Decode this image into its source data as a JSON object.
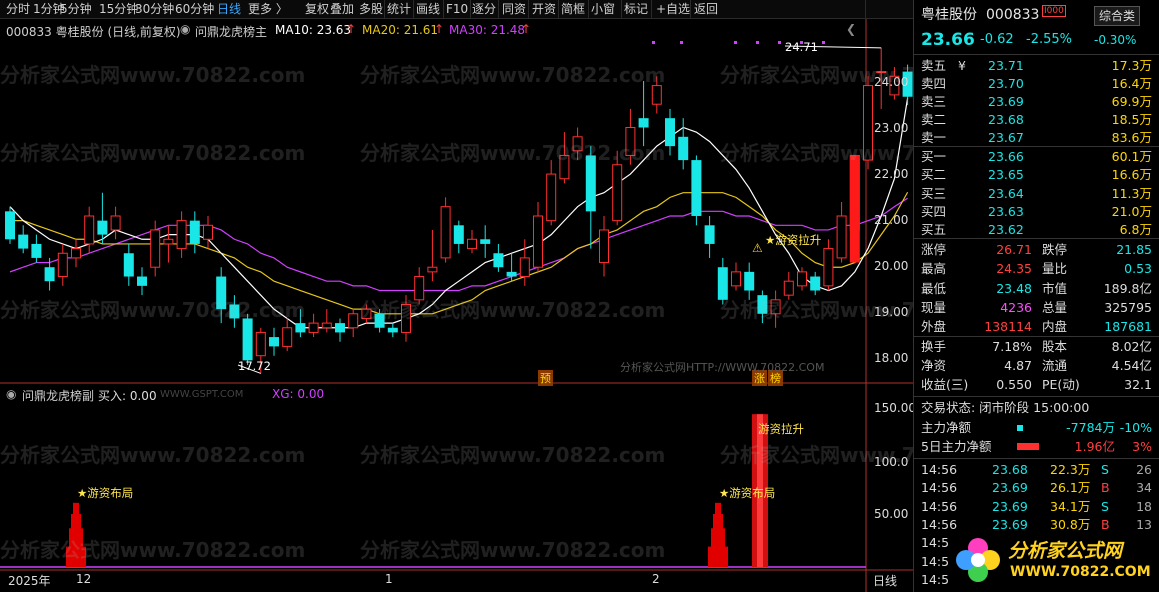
{
  "toolbar": {
    "items": [
      "分时",
      "1分钟",
      "5分钟",
      "15分钟",
      "30分钟",
      "60分钟",
      "日线",
      "更多 〉",
      "复权",
      "叠加",
      "多股",
      "统计",
      "画线",
      "F10",
      "逐分",
      "同资",
      "开资",
      "简框",
      "小窗",
      "标记",
      "+自选",
      "返回"
    ],
    "active": "日线"
  },
  "chart_header": {
    "code_title": "000833 粤桂股份 (日线,前复权)",
    "indicator_name": "问鼎龙虎榜主",
    "ma10": "MA10: 23.63",
    "ma20": "MA20: 21.61",
    "ma30": "MA30: 21.48",
    "up_arrow": "↑"
  },
  "price_axis": [
    "24.00",
    "23.00",
    "22.00",
    "21.00",
    "20.00",
    "19.00",
    "18.00"
  ],
  "labels": {
    "high": "24.71",
    "low": "17.72",
    "pre_tag": "预",
    "zhangting_tag": "涨",
    "bang_tag": "榜",
    "youzi_lasheng": "★游资拉升",
    "youzi_buju": "★游资布局",
    "watermark_url": "分析家公式网HTTP://WWW.70822.COM",
    "sub_youzi_lasheng": "游资拉升"
  },
  "sub_header": {
    "name": "问鼎龙虎榜副",
    "buy": "买入: 0.00",
    "site": "WWW.GSPT.COM",
    "xg": "XG: 0.00"
  },
  "sub_axis": [
    "150.00",
    "100.0",
    "50.00"
  ],
  "date_axis": {
    "year": "2025年",
    "m12": "12",
    "m1": "1",
    "m2": "2",
    "period": "日线"
  },
  "watermark": "分析家公式网www.70822.com",
  "stock": {
    "name": "粤桂股份",
    "code": "000833",
    "badge": "综合类",
    "price": "23.66",
    "change": "-0.62",
    "change_pct": "-2.55%",
    "small_pct": "-0.30%"
  },
  "asks": [
    {
      "label": "卖五",
      "extra": "¥",
      "price": "23.71",
      "vol": "17.3万"
    },
    {
      "label": "卖四",
      "extra": "",
      "price": "23.70",
      "vol": "16.4万"
    },
    {
      "label": "卖三",
      "extra": "",
      "price": "23.69",
      "vol": "69.9万"
    },
    {
      "label": "卖二",
      "extra": "",
      "price": "23.68",
      "vol": "18.5万"
    },
    {
      "label": "卖一",
      "extra": "",
      "price": "23.67",
      "vol": "83.6万"
    }
  ],
  "bids": [
    {
      "label": "买一",
      "price": "23.66",
      "vol": "60.1万"
    },
    {
      "label": "买二",
      "price": "23.65",
      "vol": "16.6万"
    },
    {
      "label": "买三",
      "price": "23.64",
      "vol": "11.3万"
    },
    {
      "label": "买四",
      "price": "23.63",
      "vol": "21.0万"
    },
    {
      "label": "买五",
      "price": "23.62",
      "vol": "6.8万"
    }
  ],
  "stats": [
    {
      "l1": "涨停",
      "v1": "26.71",
      "l2": "跌停",
      "v2": "21.85"
    },
    {
      "l1": "最高",
      "v1": "24.35",
      "l2": "量比",
      "v2": "0.53"
    },
    {
      "l1": "最低",
      "v1": "23.48",
      "l2": "市值",
      "v2": "189.8亿"
    },
    {
      "l1": "现量",
      "v1": "4236",
      "l2": "总量",
      "v2": "325795"
    },
    {
      "l1": "外盘",
      "v1": "138114",
      "l2": "内盘",
      "v2": "187681"
    }
  ],
  "stats2": [
    {
      "l1": "换手",
      "v1": "7.18%",
      "l2": "股本",
      "v2": "8.02亿"
    },
    {
      "l1": "净资",
      "v1": "4.87",
      "l2": "流通",
      "v2": "4.54亿"
    },
    {
      "l1": "收益(三)",
      "v1": "0.550",
      "l2": "PE(动)",
      "v2": "32.1"
    }
  ],
  "trade_status": "交易状态: 闭市阶段 15:00:00",
  "capital": [
    {
      "label": "主力净额",
      "value": "-7784万",
      "pct": "-10%"
    },
    {
      "label": "5日主力净额",
      "value": "1.96亿",
      "pct": "3%"
    }
  ],
  "ticks": [
    {
      "time": "14:56",
      "price": "23.68",
      "vol": "22.3万",
      "side": "S",
      "n": "26"
    },
    {
      "time": "14:56",
      "price": "23.69",
      "vol": "26.1万",
      "side": "B",
      "n": "34"
    },
    {
      "time": "14:56",
      "price": "23.69",
      "vol": "34.1万",
      "side": "S",
      "n": "18"
    },
    {
      "time": "14:56",
      "price": "23.69",
      "vol": "30.8万",
      "side": "B",
      "n": "13"
    },
    {
      "time": "14:5",
      "price": "",
      "vol": "",
      "side": "",
      "n": ""
    },
    {
      "time": "14:5",
      "price": "",
      "vol": "",
      "side": "",
      "n": ""
    },
    {
      "time": "14:5",
      "price": "",
      "vol": "",
      "side": "",
      "n": ""
    }
  ],
  "logo": {
    "title": "分析家公式网",
    "url": "WWW.70822.COM"
  },
  "colors": {
    "up": "#ff3030",
    "down": "#19e6e6",
    "ma10": "#ffffff",
    "ma20": "#e6c619",
    "ma30": "#d040ff",
    "bg": "#000000"
  },
  "chart_data": {
    "type": "candlestick",
    "price_ylim": [
      17.6,
      24.9
    ],
    "candles": [
      [
        21.2,
        20.6,
        21.3,
        20.5
      ],
      [
        20.7,
        20.4,
        20.9,
        20.3
      ],
      [
        20.5,
        20.2,
        20.7,
        20.1
      ],
      [
        20.0,
        19.7,
        20.2,
        19.5
      ],
      [
        19.8,
        20.3,
        20.5,
        19.6
      ],
      [
        20.2,
        20.4,
        20.6,
        20.0
      ],
      [
        20.5,
        21.1,
        21.3,
        20.3
      ],
      [
        21.0,
        20.7,
        21.6,
        20.5
      ],
      [
        20.8,
        21.1,
        21.3,
        20.6
      ],
      [
        20.3,
        19.8,
        20.5,
        19.6
      ],
      [
        19.8,
        19.6,
        20.0,
        19.4
      ],
      [
        20.0,
        20.8,
        21.0,
        19.8
      ],
      [
        20.5,
        20.6,
        20.9,
        20.1
      ],
      [
        20.4,
        21.0,
        21.2,
        20.2
      ],
      [
        21.0,
        20.5,
        21.2,
        20.3
      ],
      [
        20.6,
        20.9,
        21.1,
        20.4
      ],
      [
        19.8,
        19.1,
        20.0,
        18.8
      ],
      [
        19.2,
        18.9,
        19.4,
        18.7
      ],
      [
        18.9,
        18.0,
        19.0,
        17.9
      ],
      [
        18.1,
        18.6,
        18.7,
        17.72
      ],
      [
        18.5,
        18.3,
        18.7,
        18.1
      ],
      [
        18.3,
        18.7,
        18.9,
        18.2
      ],
      [
        18.8,
        18.6,
        19.1,
        18.5
      ],
      [
        18.6,
        18.8,
        19.0,
        18.5
      ],
      [
        18.7,
        18.8,
        19.1,
        18.6
      ],
      [
        18.8,
        18.6,
        18.9,
        18.4
      ],
      [
        18.7,
        19.0,
        19.1,
        18.5
      ],
      [
        18.9,
        19.1,
        19.2,
        18.8
      ],
      [
        19.0,
        18.7,
        19.1,
        18.6
      ],
      [
        18.7,
        18.6,
        18.8,
        18.5
      ],
      [
        18.6,
        19.2,
        19.4,
        18.4
      ],
      [
        19.3,
        19.8,
        20.0,
        19.2
      ],
      [
        19.9,
        20.0,
        20.8,
        19.7
      ],
      [
        20.2,
        21.3,
        21.5,
        20.1
      ],
      [
        20.9,
        20.5,
        21.0,
        20.3
      ],
      [
        20.4,
        20.6,
        20.8,
        20.3
      ],
      [
        20.6,
        20.5,
        20.9,
        20.2
      ],
      [
        20.3,
        20.0,
        20.5,
        19.9
      ],
      [
        19.9,
        19.8,
        20.3,
        19.7
      ],
      [
        19.8,
        20.2,
        20.6,
        19.6
      ],
      [
        20.0,
        21.1,
        21.4,
        19.9
      ],
      [
        21.0,
        22.0,
        22.3,
        20.9
      ],
      [
        21.9,
        22.4,
        22.9,
        21.8
      ],
      [
        22.5,
        22.8,
        23.0,
        22.3
      ],
      [
        22.4,
        21.2,
        22.6,
        20.4
      ],
      [
        20.1,
        20.8,
        21.1,
        19.8
      ],
      [
        21.0,
        22.2,
        22.5,
        20.9
      ],
      [
        22.4,
        23.0,
        23.4,
        22.2
      ],
      [
        23.2,
        23.0,
        24.0,
        22.6
      ],
      [
        23.5,
        23.9,
        24.1,
        23.3
      ],
      [
        23.2,
        22.6,
        23.4,
        22.4
      ],
      [
        22.8,
        22.3,
        23.2,
        22.1
      ],
      [
        22.3,
        21.1,
        22.4,
        20.9
      ],
      [
        20.9,
        20.5,
        21.1,
        20.2
      ],
      [
        20.0,
        19.3,
        20.2,
        19.2
      ],
      [
        19.6,
        19.9,
        20.1,
        19.5
      ],
      [
        19.9,
        19.5,
        20.1,
        19.3
      ],
      [
        19.4,
        19.0,
        19.5,
        18.8
      ],
      [
        19.0,
        19.3,
        19.5,
        18.7
      ],
      [
        19.4,
        19.7,
        19.9,
        19.3
      ],
      [
        19.6,
        19.9,
        20.0,
        19.5
      ],
      [
        19.8,
        19.5,
        19.9,
        19.4
      ],
      [
        19.6,
        20.4,
        20.6,
        19.5
      ],
      [
        20.2,
        21.1,
        21.4,
        20.1
      ],
      [
        20.8,
        22.4,
        22.4,
        20.7
      ],
      [
        22.3,
        23.9,
        24.1,
        22.1
      ],
      [
        24.2,
        24.2,
        24.71,
        23.4
      ],
      [
        23.7,
        24.1,
        24.3,
        23.6
      ],
      [
        24.2,
        23.66,
        24.35,
        23.48
      ]
    ],
    "ma10": [
      21.3,
      21.0,
      20.8,
      20.6,
      20.5,
      20.4,
      20.5,
      20.6,
      20.8,
      20.7,
      20.6,
      20.6,
      20.7,
      20.7,
      20.7,
      20.6,
      20.3,
      20.0,
      19.7,
      19.4,
      19.1,
      18.9,
      18.7,
      18.7,
      18.7,
      18.7,
      18.7,
      18.8,
      18.8,
      18.8,
      18.9,
      19.0,
      19.2,
      19.5,
      19.7,
      19.9,
      20.1,
      20.2,
      20.3,
      20.4,
      20.5,
      20.7,
      21.0,
      21.3,
      21.5,
      21.6,
      21.8,
      22.0,
      22.3,
      22.6,
      22.8,
      23.0,
      22.9,
      22.7,
      22.4,
      22.1,
      21.7,
      21.2,
      20.7,
      20.3,
      19.8,
      19.6,
      19.5,
      19.6,
      19.9,
      20.4,
      21.1,
      21.9,
      23.63
    ],
    "ma20": [
      21.0,
      21.0,
      20.9,
      20.8,
      20.7,
      20.6,
      20.6,
      20.5,
      20.5,
      20.5,
      20.5,
      20.5,
      20.5,
      20.5,
      20.5,
      20.4,
      20.3,
      20.2,
      20.0,
      19.9,
      19.7,
      19.6,
      19.5,
      19.4,
      19.3,
      19.2,
      19.1,
      19.1,
      19.0,
      19.0,
      19.0,
      19.0,
      19.0,
      19.1,
      19.2,
      19.3,
      19.5,
      19.6,
      19.7,
      19.8,
      19.9,
      20.0,
      20.2,
      20.4,
      20.5,
      20.7,
      20.8,
      21.0,
      21.2,
      21.3,
      21.5,
      21.6,
      21.6,
      21.6,
      21.6,
      21.5,
      21.3,
      21.1,
      20.8,
      20.6,
      20.3,
      20.1,
      20.0,
      20.0,
      20.1,
      20.3,
      20.7,
      21.1,
      21.61
    ],
    "ma30": [
      19.9,
      20.0,
      20.1,
      20.1,
      20.2,
      20.2,
      20.3,
      20.4,
      20.5,
      20.6,
      20.7,
      20.8,
      20.9,
      20.9,
      20.9,
      20.9,
      20.8,
      20.6,
      20.5,
      20.3,
      20.2,
      20.0,
      19.9,
      19.8,
      19.7,
      19.7,
      19.6,
      19.6,
      19.5,
      19.5,
      19.5,
      19.5,
      19.5,
      19.5,
      19.5,
      19.6,
      19.6,
      19.7,
      19.8,
      19.9,
      20.0,
      20.1,
      20.2,
      20.4,
      20.5,
      20.6,
      20.7,
      20.8,
      20.9,
      21.0,
      21.1,
      21.1,
      21.2,
      21.2,
      21.2,
      21.1,
      21.1,
      21.0,
      20.9,
      20.9,
      20.9,
      20.8,
      20.8,
      20.9,
      20.9,
      21.0,
      21.1,
      21.3,
      21.48
    ],
    "sub_ylim": [
      0,
      160
    ],
    "sub_bars": [
      {
        "index": 3,
        "value": 30
      },
      {
        "index": 4,
        "value": 63
      },
      {
        "index": 5,
        "value": 30
      },
      {
        "index": 62,
        "value": 30
      },
      {
        "index": 63,
        "value": 63
      },
      {
        "index": 64,
        "value": 30
      },
      {
        "index": 65,
        "value": 150
      }
    ]
  }
}
